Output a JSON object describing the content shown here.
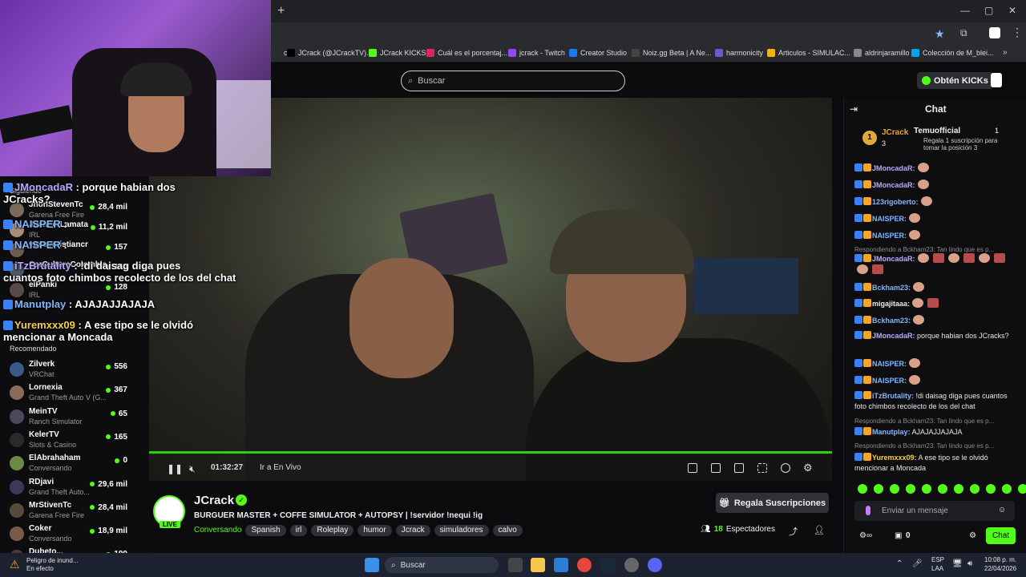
{
  "browser": {
    "bookmarks": [
      {
        "label": "ch",
        "color": "#2a2b2e"
      },
      {
        "label": "JCrack (@JCrackTV)...",
        "color": "#000000"
      },
      {
        "label": "JCrack KICKS",
        "color": "#53fc18"
      },
      {
        "label": "Cuál es el porcentaj...",
        "color": "#e0245e"
      },
      {
        "label": "jcrack - Twitch",
        "color": "#9146ff"
      },
      {
        "label": "Creator Studio",
        "color": "#1877f2"
      },
      {
        "label": "Noiz.gg Beta | A Ne...",
        "color": "#444444"
      },
      {
        "label": "harmonicity",
        "color": "#6a5acd"
      },
      {
        "label": "Articulos - SIMULAC...",
        "color": "#f4b400"
      },
      {
        "label": "aldrinjaramillo",
        "color": "#888888"
      },
      {
        "label": "Colección de M_blei...",
        "color": "#00a4ef"
      }
    ]
  },
  "header": {
    "search_placeholder": "Buscar",
    "kicks_label": "Obtén KICKs"
  },
  "sidebar": {
    "following_label": "Siguiendo",
    "following": [
      {
        "name": "JhonStevenTc",
        "category": "Garena Free Fire",
        "viewers": "28,4 mil",
        "avatar": "#7a6a5a"
      },
      {
        "name": "JuanFerLamata",
        "category": "IRL",
        "viewers": "11,2 mil",
        "avatar": "#a88c7a"
      },
      {
        "name": "yosoycristiancr",
        "category": "",
        "viewers": "157",
        "avatar": "#6b5c52"
      },
      {
        "name": "CarCultureColombia",
        "category": "",
        "viewers": "140",
        "avatar": "#4a5a6a"
      },
      {
        "name": "elPanki",
        "category": "IRL",
        "viewers": "128",
        "avatar": "#5a4a4a"
      }
    ],
    "recommended_label": "Recomendado",
    "recommended": [
      {
        "name": "Zilverk",
        "category": "VRChat",
        "viewers": "556",
        "avatar": "#3a5a8a"
      },
      {
        "name": "Lornexia",
        "category": "Grand Theft Auto V (G...",
        "viewers": "367",
        "avatar": "#8a6a5a"
      },
      {
        "name": "MeinTV",
        "category": "Ranch Simulator",
        "viewers": "65",
        "avatar": "#4a4a5a"
      },
      {
        "name": "KelerTV",
        "category": "Slots & Casino",
        "viewers": "165",
        "avatar": "#2a2a2a"
      },
      {
        "name": "ElAbrahaham",
        "category": "Conversando",
        "viewers": "0",
        "avatar": "#6a8a4a"
      },
      {
        "name": "RDjavi",
        "category": "Grand Theft Auto...",
        "viewers": "29,6 mil",
        "avatar": "#3a3a5a"
      },
      {
        "name": "MrStivenTc",
        "category": "Garena Free Fire",
        "viewers": "28,4 mil",
        "avatar": "#5a4a3a"
      },
      {
        "name": "Coker",
        "category": "Conversando",
        "viewers": "18,9 mil",
        "avatar": "#7a5a4a"
      },
      {
        "name": "Dubeto...",
        "category": "",
        "viewers": "199",
        "avatar": "#4a3a3a"
      }
    ]
  },
  "overlay_chat": [
    {
      "user": "JMoncadaR",
      "text": " : porque habian dos",
      "cont": "JCracks?",
      "cls": "u"
    },
    {
      "user": "NAISPER",
      "text": " :",
      "cont": "",
      "cls": "u2"
    },
    {
      "user": "NAISPER",
      "text": " :",
      "cont": "",
      "cls": "u2"
    },
    {
      "user": "iTzBrutality",
      "text": " : !di daisag diga pues",
      "cont": "cuantos foto chimbos recolecto de los del chat",
      "cls": "u"
    },
    {
      "user": "Manutplay",
      "text": " : AJAJAJJAJAJA",
      "cont": "",
      "cls": "u2"
    },
    {
      "user": "Yuremxxx09",
      "text": " : A ese tipo se le olvidó",
      "cont": "mencionar a Moncada",
      "cls": "u3"
    }
  ],
  "player": {
    "time": "01:32:27",
    "go_live": "Ir a En Vivo"
  },
  "stream": {
    "channel": "JCrack",
    "live_badge": "LIVE",
    "title": "BURGUER MASTER + COFFE SIMULATOR + AUTOPSY | !servidor !nequi !ig",
    "category": "Conversando",
    "tags": [
      "Spanish",
      "irl",
      "Roleplay",
      "humor",
      "Jcrack",
      "simuladores",
      "calvo"
    ],
    "gift_label": "Regala Suscripciones",
    "viewers_count": "18",
    "viewers_label": "Espectadores"
  },
  "chat": {
    "title": "Chat",
    "pinned": {
      "rank": "1",
      "user": "JCrack",
      "count": "3",
      "gifter": "Temuofficial",
      "gifter_count": "1",
      "gift_text": "Regala 1 suscripción para tomar la posición 3"
    },
    "messages": [
      {
        "user": "JMoncadaR:",
        "text": "",
        "emotes": 1,
        "color": "#bca7ff"
      },
      {
        "user": "JMoncadaR:",
        "text": "",
        "emotes": 1,
        "color": "#bca7ff"
      },
      {
        "user": "123rigoberto:",
        "text": "",
        "emotes": 1,
        "color": "#7fb7ff"
      },
      {
        "user": "NAISPER:",
        "text": "",
        "emotes": 1,
        "color": "#7fb7ff"
      },
      {
        "user": "NAISPER:",
        "text": "",
        "emotes": 1,
        "color": "#7fb7ff"
      },
      {
        "user": "JMoncadaR:",
        "text": "",
        "emotes": 8,
        "color": "#bca7ff",
        "reply": "Respondiendo a Bckham23: Tan lindo que es p..."
      },
      {
        "user": "Bckham23:",
        "text": "",
        "emotes": 1,
        "color": "#7fb7ff"
      },
      {
        "user": "migajitaaa:",
        "text": "",
        "emotes": 2,
        "color": "#e8e8e8"
      },
      {
        "user": "Bckham23:",
        "text": "",
        "emotes": 1,
        "color": "#7fb7ff"
      },
      {
        "user": "JMoncadaR:",
        "text": " porque habian dos JCracks?",
        "emotes": 0,
        "color": "#bca7ff"
      },
      {
        "user": "NAISPER:",
        "text": "",
        "emotes": 1,
        "color": "#7fb7ff"
      },
      {
        "user": "NAISPER:",
        "text": "",
        "emotes": 1,
        "color": "#7fb7ff"
      },
      {
        "user": "iTzBrutality:",
        "text": " !di daisag diga pues cuantos foto chimbos recolecto de los del chat",
        "emotes": 0,
        "color": "#7fb7ff"
      },
      {
        "user": "Manutplay:",
        "text": " AJAJAJJAJAJA",
        "emotes": 0,
        "color": "#7fb7ff",
        "reply": "Respondiendo a Bckham23: Tan lindo que es p..."
      },
      {
        "user": "Yuremxxx09:",
        "text": " A ese tipo se le olvidó mencionar a Moncada",
        "emotes": 0,
        "color": "#f5d142",
        "reply": "Respondiendo a Bckham23: Tan lindo que es p..."
      }
    ],
    "input_placeholder": "Enviar un mensaje",
    "points": "0",
    "send_label": "Chat"
  },
  "taskbar": {
    "notif_title": "Peligro de inund...",
    "notif_sub": "En efecto",
    "search_label": "Buscar",
    "lang": "ESP",
    "lang2": "LAA",
    "time": "10:08 p. m.",
    "date": "22/04/2026"
  }
}
